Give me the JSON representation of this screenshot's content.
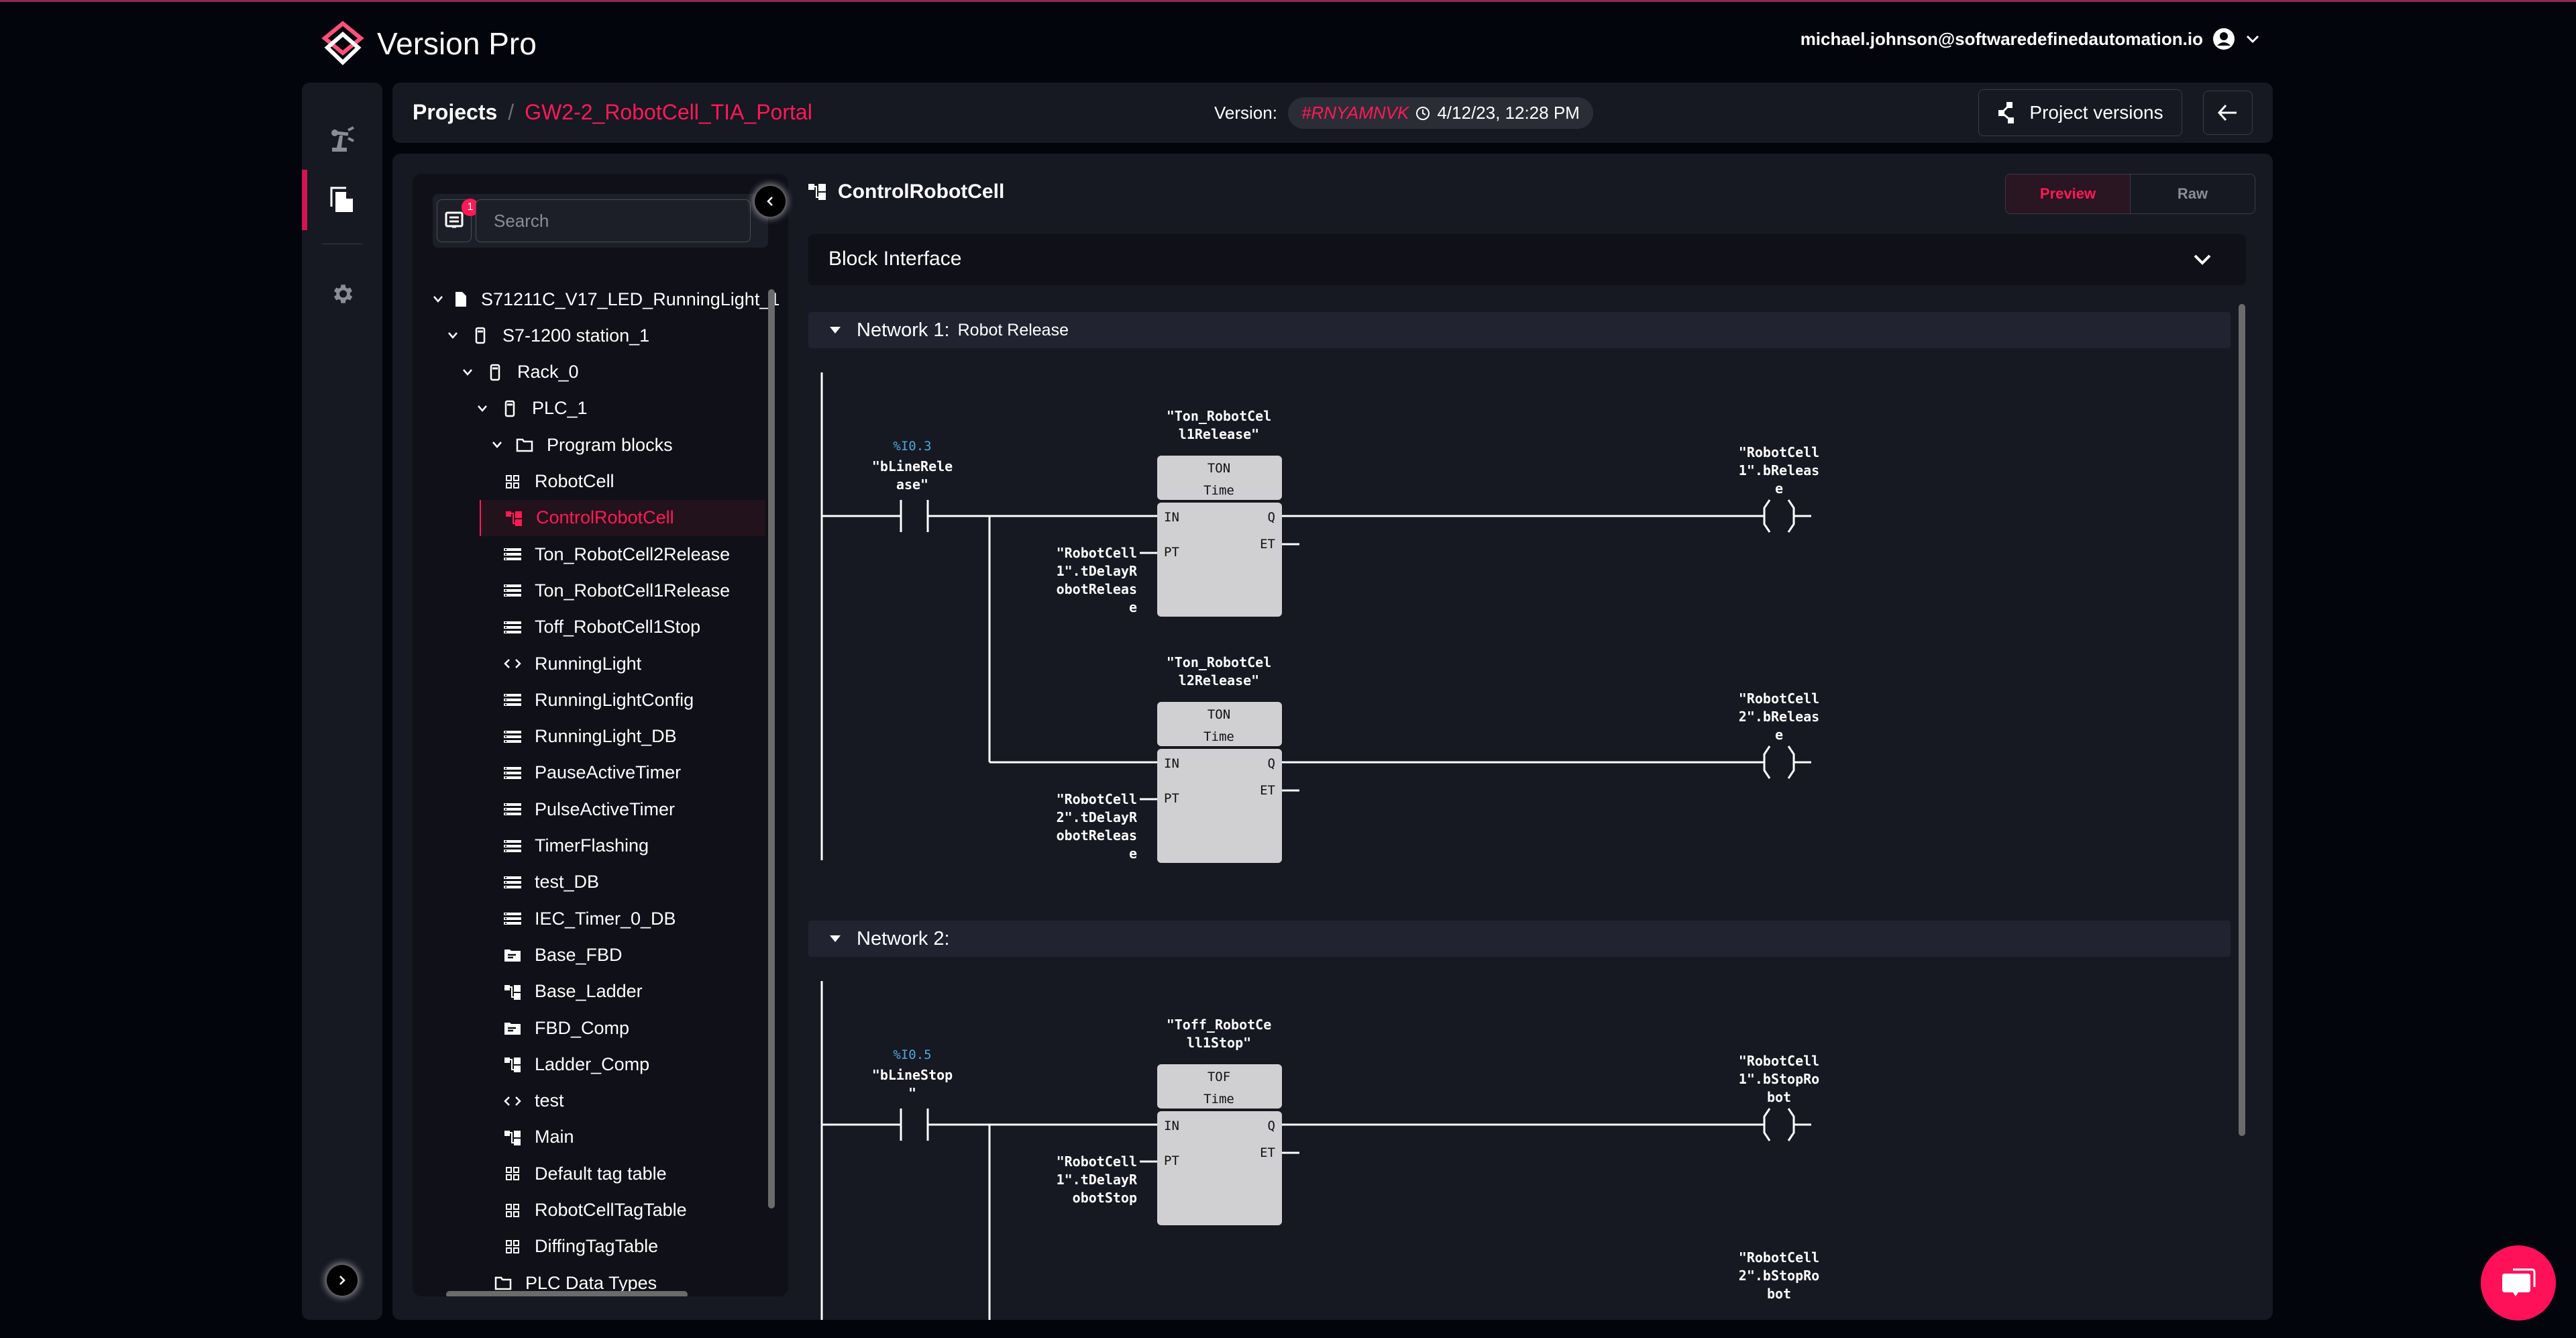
{
  "app": {
    "title": "Version Pro",
    "user_email": "michael.johnson@softwaredefinedautomation.io"
  },
  "rail": {
    "items": [
      "robot-arm",
      "files",
      "settings"
    ],
    "active": "files"
  },
  "breadcrumb": {
    "root": "Projects",
    "separator": "/",
    "project": "GW2-2_RobotCell_TIA_Portal"
  },
  "version": {
    "label": "Version:",
    "hash": "#RNYAMNVK",
    "timestamp": "4/12/23, 12:28 PM"
  },
  "toolbar": {
    "project_versions_label": "Project versions"
  },
  "tree": {
    "filter_badge": "1",
    "search_placeholder": "Search",
    "nodes": [
      {
        "label": "S71211C_V17_LED_RunningLight_1",
        "icon": "file",
        "level": 0,
        "expanded": true
      },
      {
        "label": "S7-1200 station_1",
        "icon": "device",
        "level": 1,
        "expanded": true
      },
      {
        "label": "Rack_0",
        "icon": "device",
        "level": 2,
        "expanded": true
      },
      {
        "label": "PLC_1",
        "icon": "device",
        "level": 3,
        "expanded": true
      },
      {
        "label": "Program blocks",
        "icon": "folder",
        "level": 4,
        "expanded": true
      },
      {
        "label": "RobotCell",
        "icon": "grid",
        "level": 5
      },
      {
        "label": "ControlRobotCell",
        "icon": "ladder",
        "level": 5,
        "selected": true
      },
      {
        "label": "Ton_RobotCell2Release",
        "icon": "db",
        "level": 5
      },
      {
        "label": "Ton_RobotCell1Release",
        "icon": "db",
        "level": 5
      },
      {
        "label": "Toff_RobotCell1Stop",
        "icon": "db",
        "level": 5
      },
      {
        "label": "RunningLight",
        "icon": "code",
        "level": 5
      },
      {
        "label": "RunningLightConfig",
        "icon": "db",
        "level": 5
      },
      {
        "label": "RunningLight_DB",
        "icon": "db",
        "level": 5
      },
      {
        "label": "PauseActiveTimer",
        "icon": "db",
        "level": 5
      },
      {
        "label": "PulseActiveTimer",
        "icon": "db",
        "level": 5
      },
      {
        "label": "TimerFlashing",
        "icon": "db",
        "level": 5
      },
      {
        "label": "test_DB",
        "icon": "db",
        "level": 5
      },
      {
        "label": "IEC_Timer_0_DB",
        "icon": "db",
        "level": 5
      },
      {
        "label": "Base_FBD",
        "icon": "fbd",
        "level": 5
      },
      {
        "label": "Base_Ladder",
        "icon": "ladder",
        "level": 5
      },
      {
        "label": "FBD_Comp",
        "icon": "fbd",
        "level": 5
      },
      {
        "label": "Ladder_Comp",
        "icon": "ladder",
        "level": 5
      },
      {
        "label": "test",
        "icon": "code",
        "level": 5
      },
      {
        "label": "Main",
        "icon": "ladder",
        "level": 5
      },
      {
        "label": "Default tag table",
        "icon": "grid",
        "level": 5
      },
      {
        "label": "RobotCellTagTable",
        "icon": "grid",
        "level": 5
      },
      {
        "label": "DiffingTagTable",
        "icon": "grid",
        "level": 5
      },
      {
        "label": "PLC Data Types",
        "icon": "folder",
        "level": 4
      }
    ]
  },
  "editor": {
    "block_name": "ControlRobotCell",
    "view_tabs": [
      "Preview",
      "Raw"
    ],
    "active_tab": "Preview",
    "block_interface_label": "Block Interface",
    "networks": [
      {
        "title": "Network 1:",
        "comment": "Robot Release",
        "contact": {
          "address": "%I0.3",
          "tag": [
            "\"bLineRele",
            "ase\""
          ]
        },
        "timers": [
          {
            "instance": [
              "\"Ton_RobotCel",
              "l1Release\""
            ],
            "type": "TON",
            "data_type": "Time",
            "pins_in": [
              "IN",
              "PT"
            ],
            "pins_out": [
              "Q",
              "ET"
            ],
            "pt": [
              "\"RobotCell",
              "1\".tDelayR",
              "obotReleas",
              "e"
            ],
            "coil": [
              "\"RobotCell",
              "1\".bReleas",
              "e"
            ]
          },
          {
            "instance": [
              "\"Ton_RobotCel",
              "l2Release\""
            ],
            "type": "TON",
            "data_type": "Time",
            "pins_in": [
              "IN",
              "PT"
            ],
            "pins_out": [
              "Q",
              "ET"
            ],
            "pt": [
              "\"RobotCell",
              "2\".tDelayR",
              "obotReleas",
              "e"
            ],
            "coil": [
              "\"RobotCell",
              "2\".bReleas",
              "e"
            ]
          }
        ]
      },
      {
        "title": "Network 2:",
        "comment": "",
        "contact": {
          "address": "%I0.5",
          "tag": [
            "\"bLineStop",
            "\""
          ]
        },
        "timers": [
          {
            "instance": [
              "\"Toff_RobotCe",
              "ll1Stop\""
            ],
            "type": "TOF",
            "data_type": "Time",
            "pins_in": [
              "IN",
              "PT"
            ],
            "pins_out": [
              "Q",
              "ET"
            ],
            "pt": [
              "\"RobotCell",
              "1\".tDelayR",
              "obotStop"
            ],
            "coil": [
              "\"RobotCell",
              "1\".bStopRo",
              "bot"
            ]
          }
        ],
        "extra_coil": [
          "\"RobotCell",
          "2\".bStopRo",
          "bot"
        ]
      }
    ]
  },
  "colors": {
    "accent": "#ff1a55",
    "panel": "#161822",
    "background": "#03050d",
    "address": "#4fa8d8",
    "fb_box": "#d0d0d2"
  }
}
